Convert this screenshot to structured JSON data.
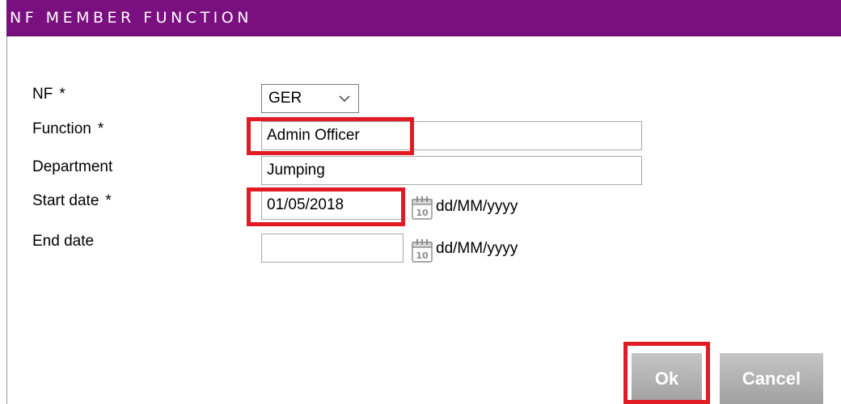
{
  "dialog": {
    "title": "NF MEMBER FUNCTION"
  },
  "required_marker": "*",
  "fields": {
    "nf": {
      "label": "NF",
      "value": "GER"
    },
    "function": {
      "label": "Function",
      "value": "Admin Officer"
    },
    "department": {
      "label": "Department",
      "value": "Jumping"
    },
    "start_date": {
      "label": "Start date",
      "value": "01/05/2018",
      "format_hint": "dd/MM/yyyy",
      "calendar_day": "10"
    },
    "end_date": {
      "label": "End date",
      "value": "",
      "format_hint": "dd/MM/yyyy",
      "calendar_day": "10"
    }
  },
  "buttons": {
    "ok": "Ok",
    "cancel": "Cancel"
  },
  "colors": {
    "title_bar": "#7a0f80",
    "highlight": "#e01b24",
    "button": "#b3b3b3"
  }
}
